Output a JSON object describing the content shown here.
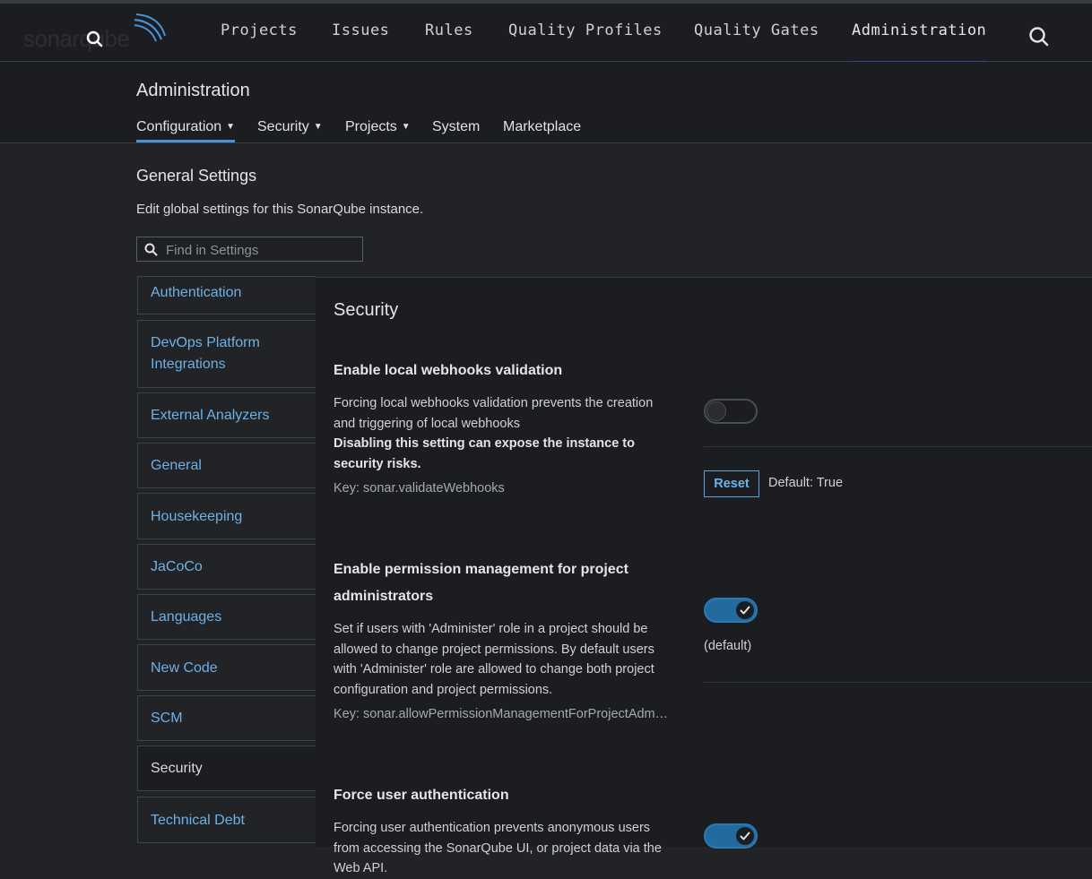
{
  "header": {
    "logo_text": "sonarqube",
    "nav": [
      {
        "label": "Projects"
      },
      {
        "label": "Issues"
      },
      {
        "label": "Rules"
      },
      {
        "label": "Quality Profiles"
      },
      {
        "label": "Quality Gates"
      },
      {
        "label": "Administration",
        "active": true
      }
    ],
    "search_icon": "search-icon"
  },
  "admin": {
    "title": "Administration",
    "tabs": [
      {
        "label": "Configuration",
        "has_caret": true,
        "active": true
      },
      {
        "label": "Security",
        "has_caret": true
      },
      {
        "label": "Projects",
        "has_caret": true
      },
      {
        "label": "System"
      },
      {
        "label": "Marketplace"
      }
    ]
  },
  "page": {
    "title": "General Settings",
    "description": "Edit global settings for this SonarQube instance.",
    "search_placeholder": "Find in Settings"
  },
  "categories": [
    {
      "label": "Authentication"
    },
    {
      "label": "DevOps Platform Integrations"
    },
    {
      "label": "External Analyzers"
    },
    {
      "label": "General"
    },
    {
      "label": "Housekeeping"
    },
    {
      "label": "JaCoCo"
    },
    {
      "label": "Languages"
    },
    {
      "label": "New Code"
    },
    {
      "label": "SCM"
    },
    {
      "label": "Security",
      "active": true
    },
    {
      "label": "Technical Debt"
    }
  ],
  "panel": {
    "title": "Security",
    "settings": [
      {
        "name": "Enable local webhooks validation",
        "desc": "Forcing local webhooks validation prevents the creation and triggering of local webhooks",
        "warning": "Disabling this setting can expose the instance to security risks.",
        "key": "Key: sonar.validateWebhooks",
        "enabled": false,
        "reset_label": "Reset",
        "default_text": "Default: True"
      },
      {
        "name": "Enable permission management for project administrators",
        "desc": "Set if users with 'Administer' role in a project should be allowed to change project permissions. By default users with 'Administer' role are allowed to change both project configuration and project permissions.",
        "key": "Key: sonar.allowPermissionManagementForProjectAdmins",
        "enabled": true,
        "default_note": "(default)"
      },
      {
        "name": "Force user authentication",
        "desc": "Forcing user authentication prevents anonymous users from accessing the SonarQube UI, or project data via the Web API.",
        "enabled": true
      }
    ]
  },
  "colors": {
    "background": "#212326",
    "panel": "#1b1d20",
    "link": "#6eb1e6",
    "accent": "#236a9e",
    "nav_underline": "#2d4d9a"
  }
}
